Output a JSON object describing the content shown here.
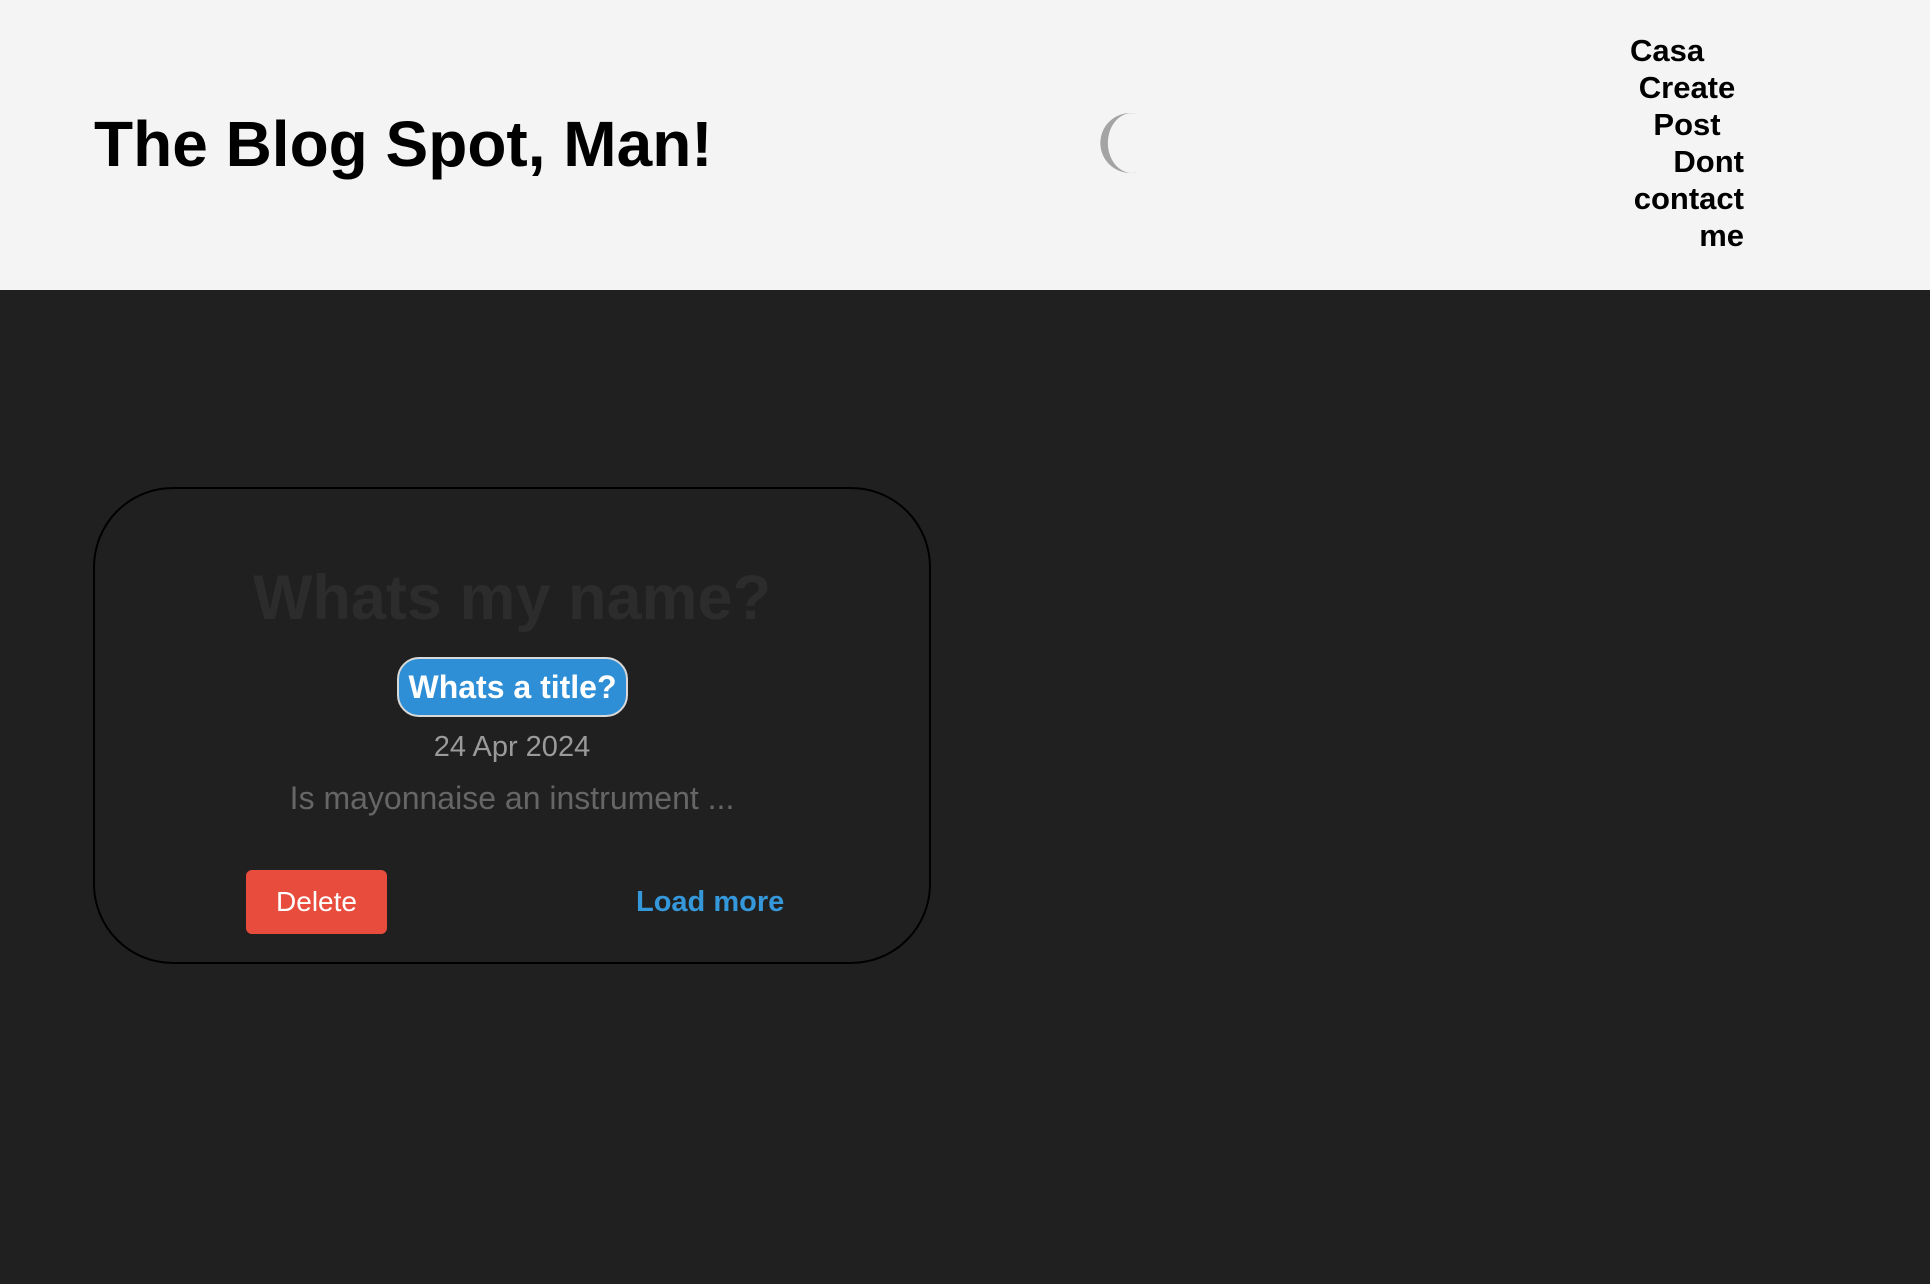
{
  "site": {
    "title": "The Blog Spot, Man!"
  },
  "theme_toggle": {
    "icon": "moon-icon",
    "color": "#a4a4a4"
  },
  "nav": {
    "home_label": "Casa",
    "create_label": "Create Post",
    "contact_label": "Dont contact me"
  },
  "post": {
    "author": "Whats my name?",
    "title": "Whats a title?",
    "date": "24 Apr 2024",
    "excerpt": "Is mayonnaise an instrument ...",
    "delete_label": "Delete",
    "load_more_label": "Load more"
  },
  "colors": {
    "header_bg": "#f4f4f4",
    "page_bg": "#202020",
    "accent": "#3498db",
    "danger": "#e74c3c"
  }
}
